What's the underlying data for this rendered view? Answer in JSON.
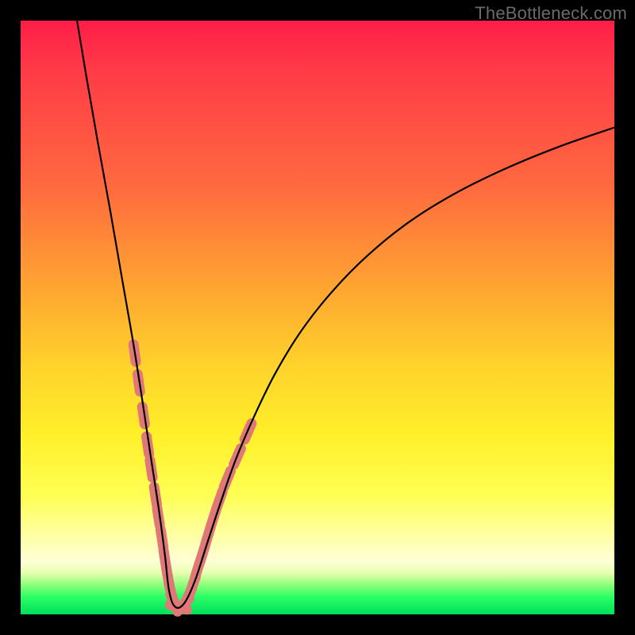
{
  "watermark": "TheBottleneck.com",
  "colors": {
    "curve_stroke": "#000000",
    "marker_fill": "#e07878",
    "marker_stroke": "#d86a6a",
    "frame": "#000000"
  },
  "chart_data": {
    "type": "line",
    "title": "",
    "xlabel": "",
    "ylabel": "",
    "xlim": [
      0,
      100
    ],
    "ylim": [
      0,
      100
    ],
    "grid": false,
    "note": "No axis ticks or numeric labels are rendered; values are estimated from pixel positions on a normalized 0–100 grid where y=0 is the bottom (green) and y=100 is the top (red).",
    "series": [
      {
        "name": "bottleneck-curve",
        "x": [
          9.5,
          11,
          13,
          15,
          17,
          19,
          20.5,
          22,
          23.3,
          24.3,
          25,
          26,
          27.5,
          29.3,
          31.3,
          33.6,
          36.2,
          39.4,
          43,
          47.3,
          52.5,
          58.5,
          65.3,
          73,
          81.5,
          90.5,
          100
        ],
        "y": [
          100,
          91,
          79.5,
          68.5,
          57,
          45.5,
          36,
          26,
          17.5,
          10,
          4,
          1.3,
          1.8,
          5.5,
          11.6,
          18.6,
          26,
          33.5,
          40.8,
          47.8,
          54.4,
          60.5,
          66,
          70.8,
          75,
          78.7,
          82
        ]
      }
    ],
    "markers": {
      "name": "highlighted-points",
      "comment": "Pink rounded-cap dash markers clustered near the valley on both branches.",
      "points": [
        {
          "x": 19.2,
          "y": 44.0
        },
        {
          "x": 19.9,
          "y": 39.0
        },
        {
          "x": 20.7,
          "y": 33.5
        },
        {
          "x": 21.4,
          "y": 28.5
        },
        {
          "x": 22.0,
          "y": 24.5
        },
        {
          "x": 22.7,
          "y": 20.0
        },
        {
          "x": 23.2,
          "y": 16.5
        },
        {
          "x": 23.8,
          "y": 12.8
        },
        {
          "x": 24.3,
          "y": 9.3
        },
        {
          "x": 24.8,
          "y": 6.3
        },
        {
          "x": 25.3,
          "y": 3.8
        },
        {
          "x": 25.9,
          "y": 2.0
        },
        {
          "x": 26.6,
          "y": 1.2
        },
        {
          "x": 27.4,
          "y": 1.6
        },
        {
          "x": 28.2,
          "y": 3.0
        },
        {
          "x": 29.0,
          "y": 5.0
        },
        {
          "x": 29.8,
          "y": 7.6
        },
        {
          "x": 30.7,
          "y": 10.4
        },
        {
          "x": 31.6,
          "y": 13.4
        },
        {
          "x": 32.5,
          "y": 16.3
        },
        {
          "x": 33.5,
          "y": 19.3
        },
        {
          "x": 34.8,
          "y": 22.8
        },
        {
          "x": 36.5,
          "y": 26.6
        },
        {
          "x": 38.3,
          "y": 30.8
        }
      ]
    }
  }
}
